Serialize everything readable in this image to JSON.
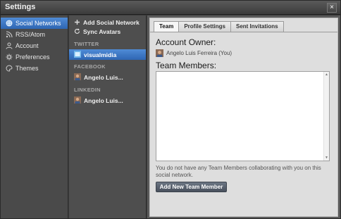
{
  "window": {
    "title": "Settings",
    "close_glyph": "×"
  },
  "nav": {
    "items": [
      {
        "label": "Social Networks",
        "icon": "globe-icon",
        "active": true
      },
      {
        "label": "RSS/Atom",
        "icon": "rss-icon"
      },
      {
        "label": "Account",
        "icon": "user-icon"
      },
      {
        "label": "Preferences",
        "icon": "gear-icon"
      },
      {
        "label": "Themes",
        "icon": "palette-icon"
      }
    ]
  },
  "mid": {
    "add_label": "Add Social Network",
    "sync_label": "Sync Avatars",
    "groups": [
      {
        "header": "TWITTER",
        "account": "visualmidia"
      },
      {
        "header": "FACEBOOK",
        "account": "Angelo Luis..."
      },
      {
        "header": "LINKEDIN",
        "account": "Angelo Luis..."
      }
    ]
  },
  "tabs": [
    "Team",
    "Profile Settings",
    "Sent Invitations"
  ],
  "team": {
    "owner_heading": "Account Owner:",
    "owner_name": "Angelo Luis Ferreira (You)",
    "members_heading": "Team Members:",
    "empty_message": "You do not have any Team Members collaborating with you on this social network.",
    "add_button": "Add New Team Member"
  },
  "colors": {
    "accent": "#3a76c6",
    "chrome": "#3a3a3a"
  }
}
